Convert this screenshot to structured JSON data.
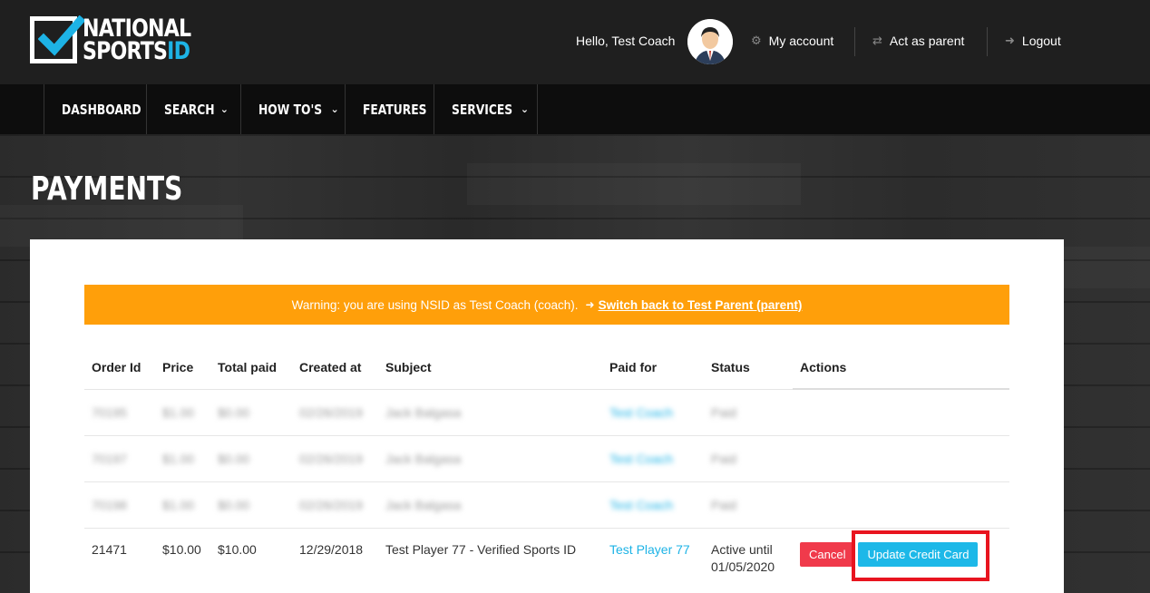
{
  "header": {
    "logo_line1": "NATIONAL",
    "logo_line2": "SPORTS",
    "logo_line2_accent": "ID",
    "greeting": "Hello, Test Coach",
    "links": [
      {
        "label": "My account",
        "icon": "gear-icon"
      },
      {
        "label": "Act as parent",
        "icon": "swap-arrows-icon"
      },
      {
        "label": "Logout",
        "icon": "sign-out-icon"
      }
    ]
  },
  "nav": {
    "items": [
      {
        "label": "DASHBOARD",
        "has_dropdown": false
      },
      {
        "label": "SEARCH",
        "has_dropdown": true
      },
      {
        "label": "HOW TO'S",
        "has_dropdown": true
      },
      {
        "label": "FEATURES",
        "has_dropdown": false
      },
      {
        "label": "SERVICES",
        "has_dropdown": true
      }
    ]
  },
  "page": {
    "title": "PAYMENTS"
  },
  "warning": {
    "text": "Warning: you are using NSID as Test Coach (coach).",
    "switch_link": "Switch back to Test Parent (parent)",
    "color": "#ff9f0a"
  },
  "table": {
    "headers": [
      "Order Id",
      "Price",
      "Total paid",
      "Created at",
      "Subject",
      "Paid for",
      "Status",
      "Actions"
    ],
    "blurred_rows": [
      [
        "70195",
        "$1.00",
        "$0.00",
        "02/26/2019",
        "Jack Balgasa",
        "Test Coach",
        "Paid"
      ],
      [
        "70197",
        "$1.00",
        "$0.00",
        "02/26/2019",
        "Jack Balgasa",
        "Test Coach",
        "Paid"
      ],
      [
        "70198",
        "$1.00",
        "$0.00",
        "02/26/2019",
        "Jack Balgasa",
        "Test Coach",
        "Paid"
      ]
    ],
    "last_row": {
      "order_id": "21471",
      "price": "$10.00",
      "total_paid": "$10.00",
      "created_at": "12/29/2018",
      "subject": "Test Player 77 - Verified Sports ID",
      "paid_for": "Test Player 77",
      "status_line1": "Active until",
      "status_line2": "01/05/2020",
      "cancel_label": "Cancel",
      "update_label": "Update Credit Card"
    }
  },
  "colors": {
    "accent_blue": "#1db3e6",
    "cancel_red": "#f03a4b",
    "highlight_red": "#e8141f"
  }
}
